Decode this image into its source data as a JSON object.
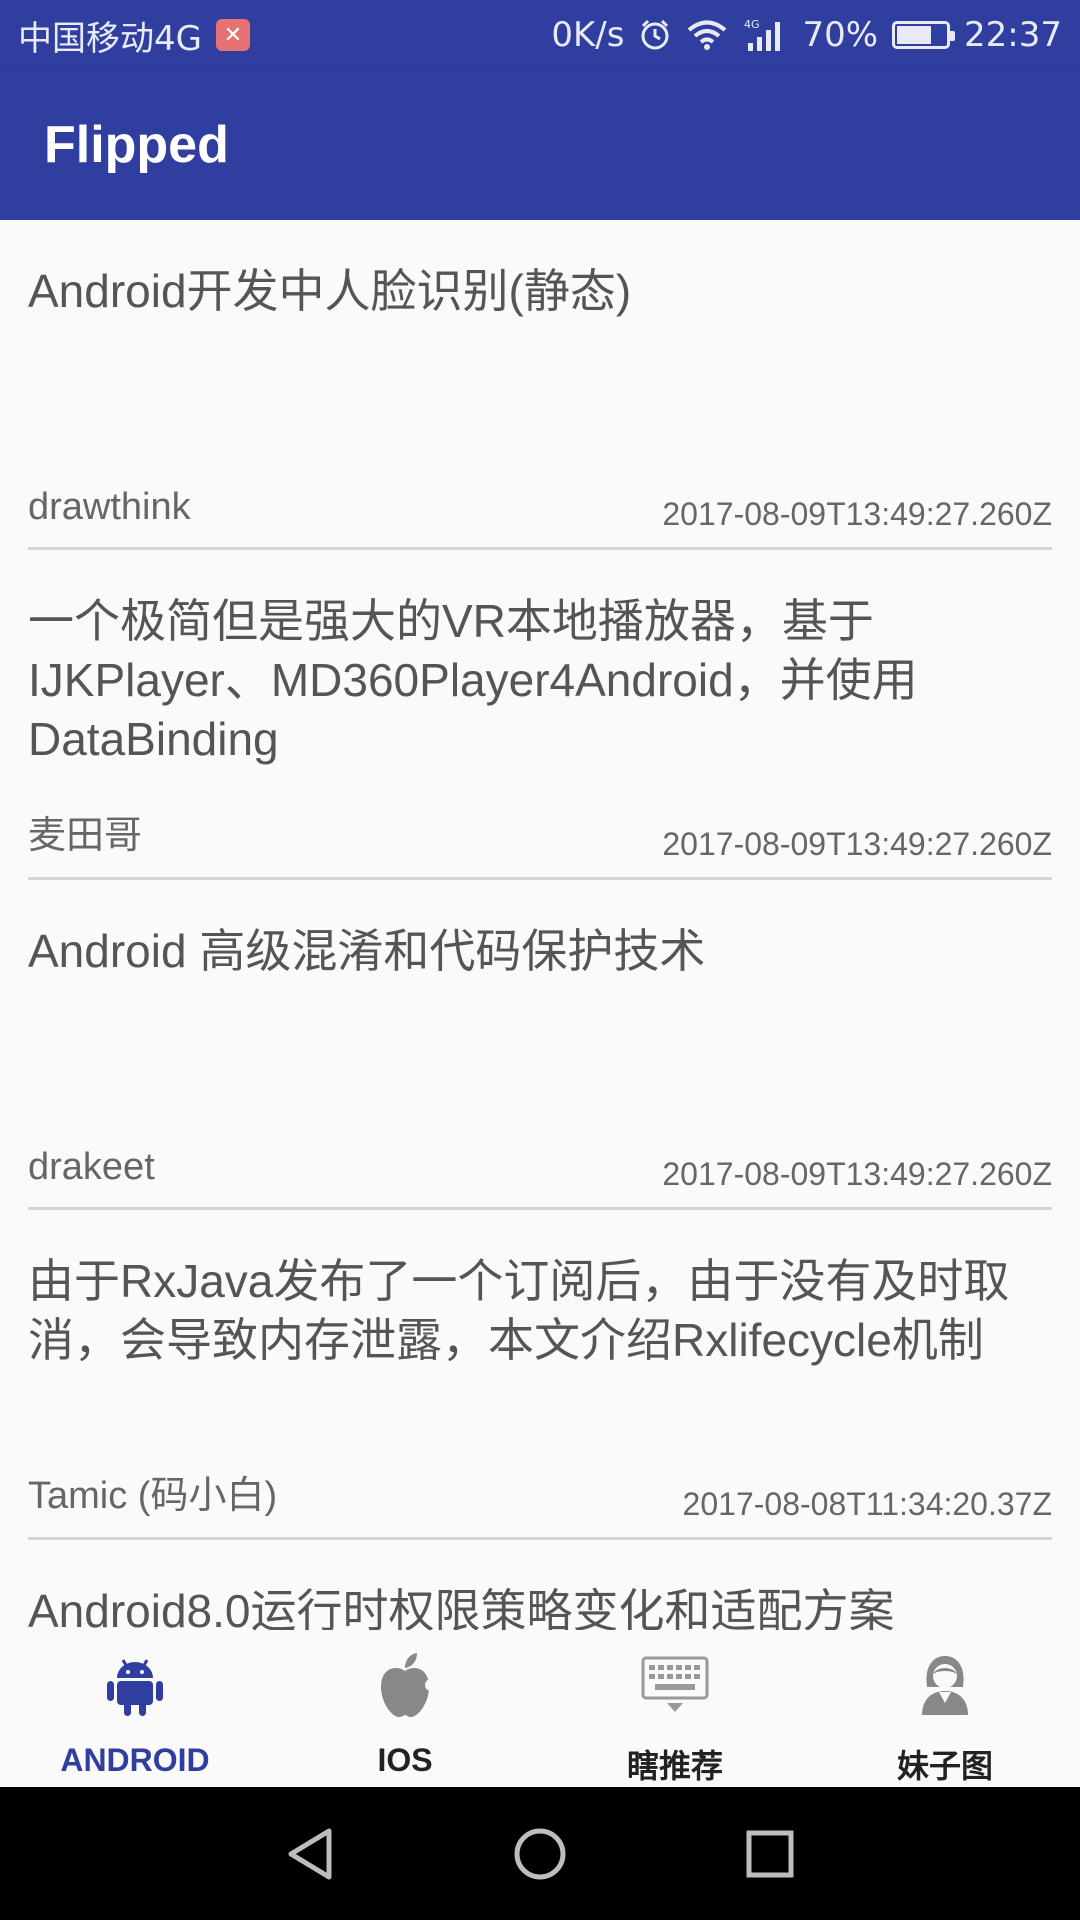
{
  "status_bar": {
    "carrier": "中国移动4G",
    "speed": "0K/s",
    "network": "4G",
    "battery": "70%",
    "battery_level": 0.7,
    "time": "22:37"
  },
  "app_bar": {
    "title": "Flipped"
  },
  "articles": [
    {
      "title": "Android开发中人脸识别(静态)",
      "author": "drawthink",
      "time": "2017-08-09T13:49:27.260Z"
    },
    {
      "title": "一个极简但是强大的VR本地播放器，基于IJKPlayer、MD360Player4Android，并使用DataBinding",
      "author": "麦田哥",
      "time": "2017-08-09T13:49:27.260Z"
    },
    {
      "title": "Android 高级混淆和代码保护技术",
      "author": "drakeet",
      "time": "2017-08-09T13:49:27.260Z"
    },
    {
      "title": "由于RxJava发布了一个订阅后，由于没有及时取消，会导致内存泄露，本文介绍Rxlifecycle机制",
      "author": "Tamic (码小白)",
      "time": "2017-08-08T11:34:20.37Z"
    },
    {
      "title": "Android8.0运行时权限策略变化和适配方案",
      "author": "",
      "time": ""
    }
  ],
  "bottom_nav": {
    "items": [
      {
        "label": "ANDROID",
        "icon": "android-icon",
        "active": true
      },
      {
        "label": "IOS",
        "icon": "apple-icon",
        "active": false
      },
      {
        "label": "瞎推荐",
        "icon": "keyboard-icon",
        "active": false
      },
      {
        "label": "妹子图",
        "icon": "girl-icon",
        "active": false
      }
    ]
  },
  "colors": {
    "primary": "#303f9f",
    "background": "#fafafa",
    "text": "#555555"
  }
}
